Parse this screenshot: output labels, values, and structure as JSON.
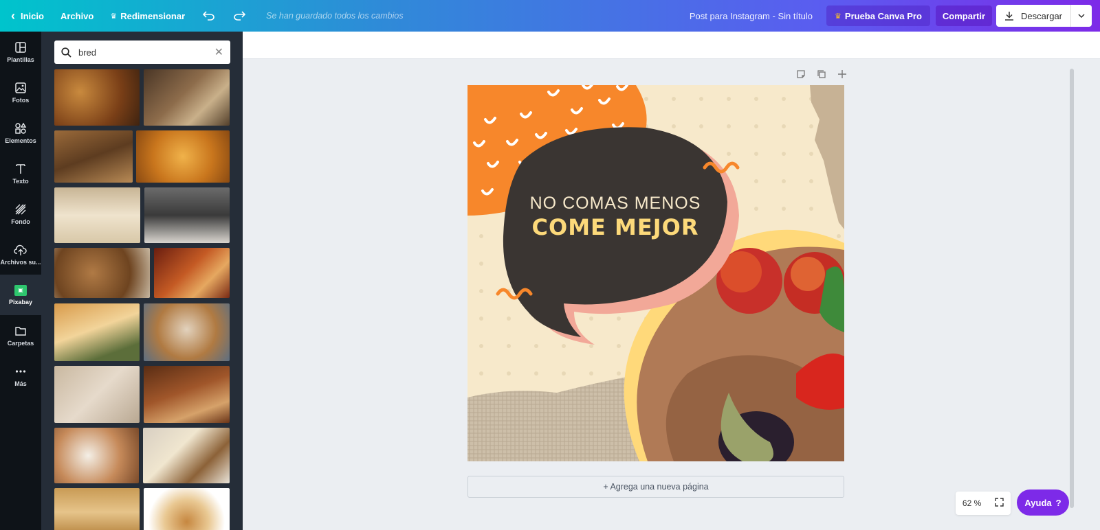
{
  "topbar": {
    "home_label": "Inicio",
    "file_label": "Archivo",
    "resize_label": "Redimensionar",
    "saved_status": "Se han guardado todos los cambios",
    "doc_title": "Post para Instagram - Sin título",
    "pro_label": "Prueba Canva Pro",
    "share_label": "Compartir",
    "download_label": "Descargar"
  },
  "rail": {
    "items": [
      {
        "label": "Plantillas",
        "icon": "layout-icon"
      },
      {
        "label": "Fotos",
        "icon": "image-icon"
      },
      {
        "label": "Elementos",
        "icon": "shapes-icon"
      },
      {
        "label": "Texto",
        "icon": "text-icon"
      },
      {
        "label": "Fondo",
        "icon": "pattern-icon"
      },
      {
        "label": "Archivos su...",
        "icon": "cloud-upload-icon"
      },
      {
        "label": "Pixabay",
        "icon": "pixabay-icon"
      },
      {
        "label": "Carpetas",
        "icon": "folder-icon"
      },
      {
        "label": "Más",
        "icon": "more-icon"
      }
    ]
  },
  "panel": {
    "search_value": "bred"
  },
  "design": {
    "line1": "NO COMAS MENOS",
    "line2": "COME MEJOR"
  },
  "canvas": {
    "add_page_label": "+ Agrega una nueva página",
    "zoom_label": "62 %",
    "help_label": "Ayuda"
  },
  "colors": {
    "accent": "#7d2ae8",
    "teal": "#00c4cc",
    "orange": "#f7872b",
    "bubble": "#3a3532",
    "headline_yellow": "#fcd97a"
  }
}
